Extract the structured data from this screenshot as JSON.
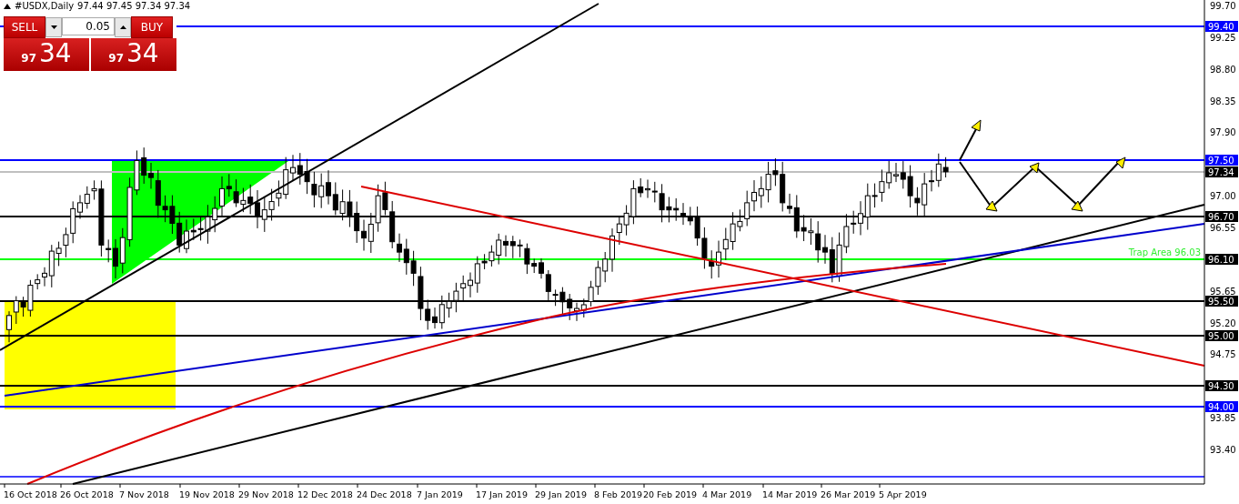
{
  "chart_header": {
    "symbol": "#USDX,Daily",
    "quotes": "97.44 97.45 97.34 97.34"
  },
  "trade_panel": {
    "sell_label": "SELL",
    "buy_label": "BUY",
    "lot": "0.05",
    "sell_price_big": "97",
    "sell_price_small": "34",
    "buy_price_big": "97",
    "buy_price_small": "34"
  },
  "price_axis": [
    "99.70",
    "99.25",
    "98.80",
    "98.35",
    "97.90",
    "97.00",
    "96.55",
    "95.65",
    "95.20",
    "94.75",
    "93.85",
    "93.40"
  ],
  "levels": [
    {
      "label": "99.40",
      "color": "#0000ff"
    },
    {
      "label": "97.50",
      "color": "#0000ff"
    },
    {
      "label": "97.34",
      "color": "#c0c0c0"
    },
    {
      "label": "96.70",
      "color": "#000000"
    },
    {
      "label": "96.10",
      "color": "#00ff00"
    },
    {
      "label": "95.50",
      "color": "#000000"
    },
    {
      "label": "95.00",
      "color": "#000000"
    },
    {
      "label": "94.30",
      "color": "#000000"
    },
    {
      "label": "94.00",
      "color": "#0000ff"
    }
  ],
  "trap_area": {
    "label": "Trap Area",
    "value": "96.03"
  },
  "time_axis": [
    "16 Oct 2018",
    "26 Oct 2018",
    "7 Nov 2018",
    "19 Nov 2018",
    "29 Nov 2018",
    "12 Dec 2018",
    "24 Dec 2018",
    "7 Jan 2019",
    "17 Jan 2019",
    "29 Jan 2019",
    "8 Feb 2019",
    "20 Feb 2019",
    "4 Mar 2019",
    "14 Mar 2019",
    "26 Mar 2019",
    "5 Apr 2019"
  ]
}
